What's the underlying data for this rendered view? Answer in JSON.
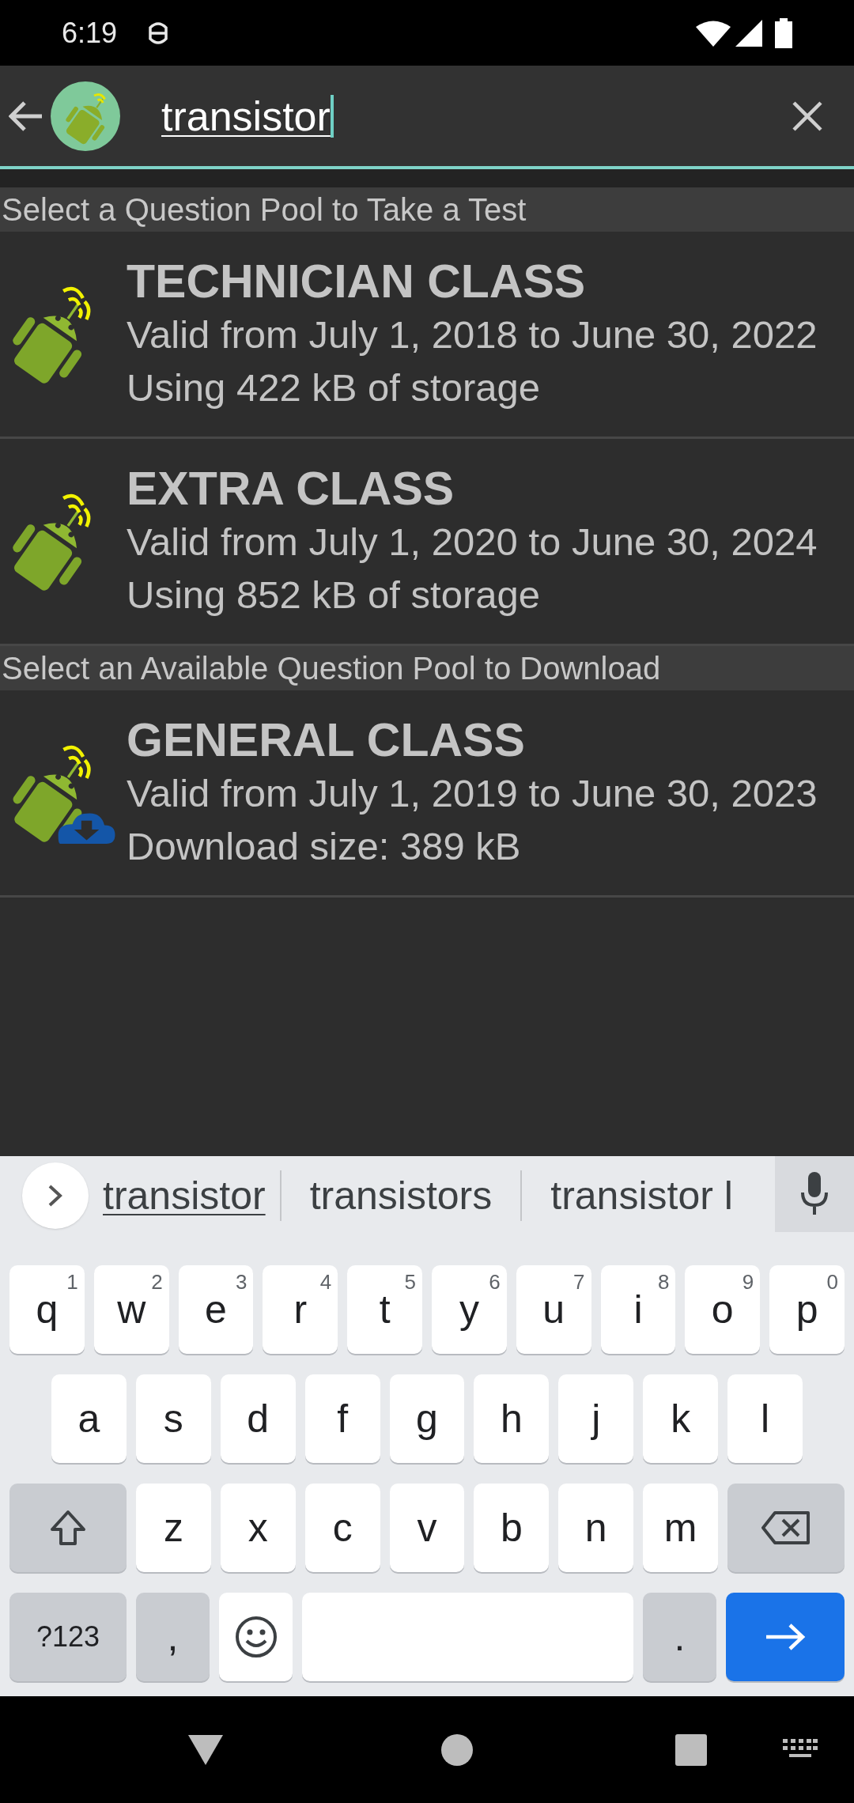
{
  "status_bar": {
    "time": "6:19"
  },
  "search": {
    "value": "transistor"
  },
  "sections": [
    {
      "header": "Select a Question Pool to Take a Test",
      "pools": [
        {
          "kind": "installed",
          "title": "TECHNICIAN CLASS",
          "lines": [
            "Valid from July 1, 2018 to June 30, 2022",
            "Using 422 kB of storage"
          ]
        },
        {
          "kind": "installed",
          "title": "EXTRA CLASS",
          "lines": [
            "Valid from July 1, 2020 to June 30, 2024",
            "Using 852 kB of storage"
          ]
        }
      ]
    },
    {
      "header": "Select an Available Question Pool to Download",
      "pools": [
        {
          "kind": "download",
          "title": "GENERAL CLASS",
          "lines": [
            "Valid from July 1, 2019 to June 30, 2023",
            "Download size: 389 kB"
          ]
        }
      ]
    }
  ],
  "keyboard": {
    "suggestions": [
      {
        "text": "transistor",
        "selected": true
      },
      {
        "text": "transistors",
        "selected": false
      },
      {
        "text": "transistor l",
        "selected": false
      }
    ],
    "rows": [
      {
        "keys": [
          {
            "kind": "letter",
            "label": "q",
            "hint": "1"
          },
          {
            "kind": "letter",
            "label": "w",
            "hint": "2"
          },
          {
            "kind": "letter",
            "label": "e",
            "hint": "3"
          },
          {
            "kind": "letter",
            "label": "r",
            "hint": "4"
          },
          {
            "kind": "letter",
            "label": "t",
            "hint": "5"
          },
          {
            "kind": "letter",
            "label": "y",
            "hint": "6"
          },
          {
            "kind": "letter",
            "label": "u",
            "hint": "7"
          },
          {
            "kind": "letter",
            "label": "i",
            "hint": "8"
          },
          {
            "kind": "letter",
            "label": "o",
            "hint": "9"
          },
          {
            "kind": "letter",
            "label": "p",
            "hint": "0"
          }
        ]
      },
      {
        "keys": [
          {
            "kind": "letter",
            "label": "a"
          },
          {
            "kind": "letter",
            "label": "s"
          },
          {
            "kind": "letter",
            "label": "d"
          },
          {
            "kind": "letter",
            "label": "f"
          },
          {
            "kind": "letter",
            "label": "g"
          },
          {
            "kind": "letter",
            "label": "h"
          },
          {
            "kind": "letter",
            "label": "j"
          },
          {
            "kind": "letter",
            "label": "k"
          },
          {
            "kind": "letter",
            "label": "l"
          }
        ]
      },
      {
        "keys": [
          {
            "kind": "shift"
          },
          {
            "kind": "letter",
            "label": "z"
          },
          {
            "kind": "letter",
            "label": "x"
          },
          {
            "kind": "letter",
            "label": "c"
          },
          {
            "kind": "letter",
            "label": "v"
          },
          {
            "kind": "letter",
            "label": "b"
          },
          {
            "kind": "letter",
            "label": "n"
          },
          {
            "kind": "letter",
            "label": "m"
          },
          {
            "kind": "backspace"
          }
        ]
      },
      {
        "keys": [
          {
            "kind": "symbols",
            "label": "?123"
          },
          {
            "kind": "punct",
            "label": ","
          },
          {
            "kind": "emoji"
          },
          {
            "kind": "space"
          },
          {
            "kind": "punct",
            "label": "."
          },
          {
            "kind": "enter"
          }
        ]
      }
    ]
  }
}
